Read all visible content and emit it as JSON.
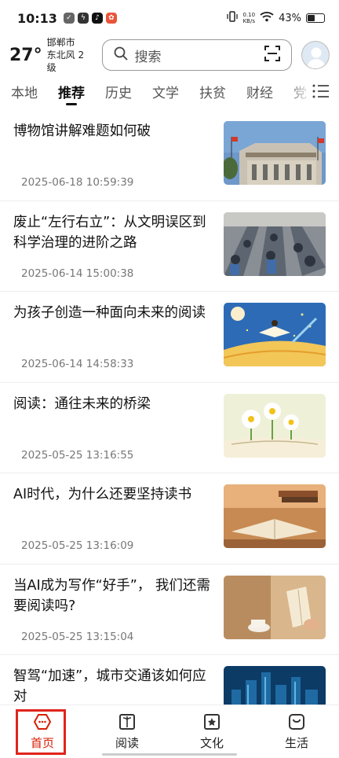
{
  "status_bar": {
    "time": "10:13",
    "net_speed_value": "0.10",
    "net_speed_unit": "KB/s",
    "battery": "43%"
  },
  "header": {
    "temperature": "27°",
    "city": "邯郸市",
    "wind": "东北风 2级",
    "search_placeholder": "搜索"
  },
  "tabs": [
    {
      "label": "本地"
    },
    {
      "label": "推荐",
      "active": true
    },
    {
      "label": "历史"
    },
    {
      "label": "文学"
    },
    {
      "label": "扶贫"
    },
    {
      "label": "财经"
    },
    {
      "label": "党"
    }
  ],
  "articles": [
    {
      "title": "博物馆讲解难题如何破",
      "date": "2025-06-18 10:59:39",
      "image": "museum-building"
    },
    {
      "title": "废止“左行右立”：从文明误区到科学治理的进阶之路",
      "date": "2025-06-14 15:00:38",
      "image": "escalator-crowd"
    },
    {
      "title": "为孩子创造一种面向未来的阅读",
      "date": "2025-06-14 14:58:33",
      "image": "child-reading-illustration"
    },
    {
      "title": "阅读：通往未来的桥梁",
      "date": "2025-05-25 13:16:55",
      "image": "daisies-and-book"
    },
    {
      "title": "AI时代，为什么还要坚持读书",
      "date": "2025-05-25 13:16:09",
      "image": "open-books"
    },
    {
      "title": "当AI成为写作“好手”， 我们还需要阅读吗?",
      "date": "2025-05-25 13:15:04",
      "image": "woman-reading"
    },
    {
      "title": "智驾“加速”，城市交通该如何应对",
      "date": "",
      "image": "city-skyline"
    }
  ],
  "bottom_nav": [
    {
      "label": "首页",
      "icon": "home-icon",
      "active": true
    },
    {
      "label": "阅读",
      "icon": "book-icon"
    },
    {
      "label": "文化",
      "icon": "star-badge-icon"
    },
    {
      "label": "生活",
      "icon": "bag-icon"
    }
  ],
  "colors": {
    "accent": "#d81e06",
    "highlight": "#e0241b"
  }
}
